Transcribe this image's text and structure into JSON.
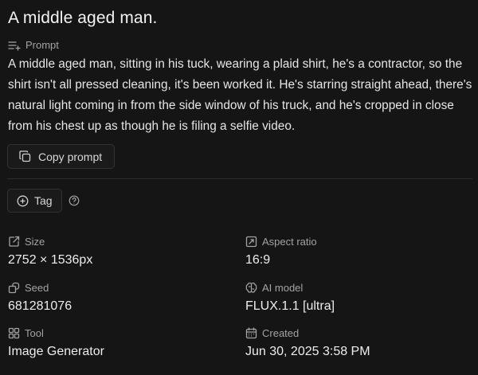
{
  "title": "A middle aged man.",
  "prompt": {
    "label": "Prompt",
    "icon": "text-lines-plus-icon",
    "text": "A middle aged man, sitting in his tuck, wearing a plaid shirt, he's a contractor, so the shirt isn't all pressed cleaning, it's been worked it. He's starring straight ahead, there's natural light coming in from the side window of his truck, and he's cropped in close from his chest up as though he is filing a selfie video."
  },
  "actions": {
    "copy_label": "Copy prompt",
    "copy_icon": "copy-icon",
    "tag_label": "Tag",
    "tag_icon": "plus-circle-icon",
    "help_icon": "question-circle-icon"
  },
  "details": {
    "size": {
      "label": "Size",
      "value": "2752 × 1536px",
      "icon": "resize-icon"
    },
    "aspect_ratio": {
      "label": "Aspect ratio",
      "value": "16:9",
      "icon": "aspect-ratio-icon"
    },
    "seed": {
      "label": "Seed",
      "value": "681281076",
      "icon": "seed-icon"
    },
    "ai_model": {
      "label": "AI model",
      "value": "FLUX.1.1 [ultra]",
      "icon": "brain-icon"
    },
    "tool": {
      "label": "Tool",
      "value": "Image Generator",
      "icon": "grid-icon"
    },
    "created": {
      "label": "Created",
      "value": "Jun 30, 2025 3:58 PM",
      "icon": "calendar-icon"
    }
  },
  "colors": {
    "background": "#151515",
    "text": "#ececec",
    "muted": "#a3a3a3",
    "border": "#333333"
  }
}
